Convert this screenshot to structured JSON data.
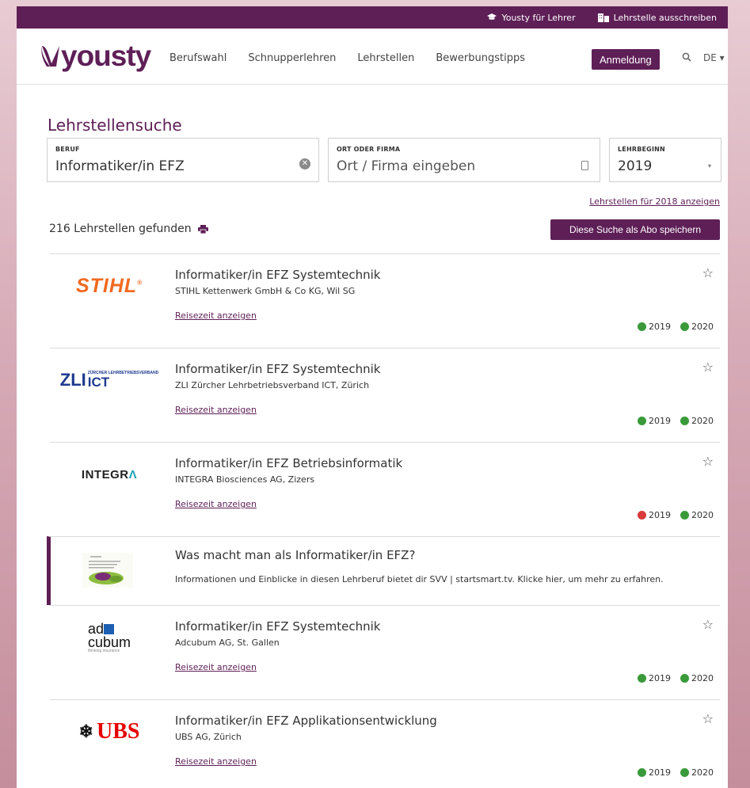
{
  "topbar": {
    "teacher_label": "Yousty für Lehrer",
    "post_label": "Lehrstelle ausschreiben"
  },
  "nav": {
    "logo": "yousty",
    "links": [
      "Berufswahl",
      "Schnupperlehren",
      "Lehrstellen",
      "Bewerbungstipps"
    ],
    "login": "Anmeldung",
    "lang": "DE ▾"
  },
  "search": {
    "title": "Lehrstellensuche",
    "beruf_label": "BERUF",
    "beruf_value": "Informatiker/in EFZ",
    "ort_label": "ORT ODER FIRMA",
    "ort_placeholder": "Ort / Firma eingeben",
    "start_label": "LEHRBEGINN",
    "start_value": "2019",
    "link_2018": "Lehrstellen für 2018 anzeigen",
    "count": "216 Lehrstellen gefunden",
    "save_button": "Diese Suche als Abo speichern"
  },
  "results": [
    {
      "logo": "STIHL",
      "job": "Informatiker/in EFZ Systemtechnik",
      "company": "STIHL Kettenwerk GmbH & Co KG, Wil SG",
      "travel": "Reisezeit anzeigen",
      "years": [
        {
          "year": "2019",
          "status": "green"
        },
        {
          "year": "2020",
          "status": "green"
        }
      ]
    },
    {
      "logo": "ZLI ICT",
      "job": "Informatiker/in EFZ Systemtechnik",
      "company": "ZLI Zürcher Lehrbetriebsverband ICT, Zürich",
      "travel": "Reisezeit anzeigen",
      "years": [
        {
          "year": "2019",
          "status": "green"
        },
        {
          "year": "2020",
          "status": "green"
        }
      ]
    },
    {
      "logo": "INTEGRA",
      "job": "Informatiker/in EFZ Betriebsinformatik",
      "company": "INTEGRA Biosciences AG, Zizers",
      "travel": "Reisezeit anzeigen",
      "years": [
        {
          "year": "2019",
          "status": "red"
        },
        {
          "year": "2020",
          "status": "green"
        }
      ]
    },
    {
      "logo": "adcubum",
      "job": "Informatiker/in EFZ Systemtechnik",
      "company": "Adcubum AG, St. Gallen",
      "travel": "Reisezeit anzeigen",
      "years": [
        {
          "year": "2019",
          "status": "green"
        },
        {
          "year": "2020",
          "status": "green"
        }
      ]
    },
    {
      "logo": "UBS",
      "job": "Informatiker/in EFZ Applikationsentwicklung",
      "company": "UBS AG, Zürich",
      "travel": "Reisezeit anzeigen",
      "years": [
        {
          "year": "2019",
          "status": "green"
        },
        {
          "year": "2020",
          "status": "green"
        }
      ]
    }
  ],
  "promo": {
    "title": "Was macht man als Informatiker/in EFZ?",
    "description": "Informationen und Einblicke in diesen Lehrberuf bietet dir SVV | startsmart.tv. Klicke hier, um mehr zu erfahren."
  },
  "logos": {
    "stihl": "STIHL",
    "stihl_mark": "®",
    "zli_big": "ZLI",
    "zli_small": "ZÜRCHER LEHRBETRIEBSVERBAND",
    "zli_ict": "ICT",
    "integra_main": "INTEGR",
    "integra_accent": "Λ",
    "adcubum_1": "ad",
    "adcubum_2": "cubum",
    "adcubum_tag": "thinking insurance",
    "ubs": "UBS"
  },
  "colors": {
    "brand": "#5e1f57",
    "green": "#3a9a3a",
    "red": "#d93a3a"
  }
}
